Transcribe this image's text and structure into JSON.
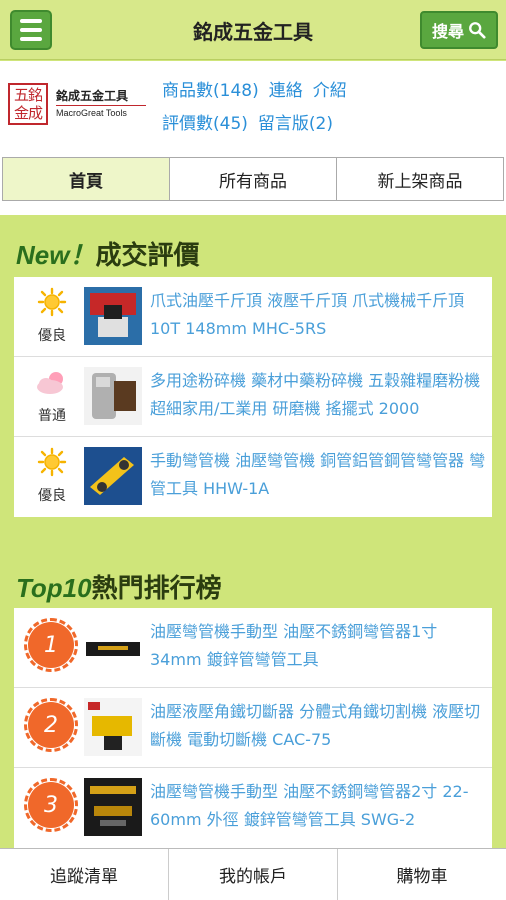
{
  "header": {
    "title": "銘成五金工具",
    "search_label": "搜尋"
  },
  "store": {
    "logo_mark": "五銘金成",
    "logo_name": "銘成五金工具",
    "logo_en": "MacroGreat Tools",
    "products_count": "商品數(148)",
    "contact": "連絡",
    "intro": "介紹",
    "reviews_count": "評價數(45)",
    "guestbook": "留言版(2)"
  },
  "tabs": [
    {
      "label": "首頁"
    },
    {
      "label": "所有商品"
    },
    {
      "label": "新上架商品"
    }
  ],
  "reviews": {
    "title_prefix": "New！",
    "title": "成交評價",
    "items": [
      {
        "rating": "優良",
        "icon": "sun-icon",
        "text": "爪式油壓千斤頂 液壓千斤頂 爪式機械千斤頂 10T 148mm MHC-5RS"
      },
      {
        "rating": "普通",
        "icon": "cloud-sun-icon",
        "text": "多用途粉碎機 藥材中藥粉碎機 五穀雜糧磨粉機 超細家用/工業用 研磨機 搖擺式 2000"
      },
      {
        "rating": "優良",
        "icon": "sun-icon",
        "text": "手動彎管機 油壓彎管機 銅管鋁管鋼管彎管器 彎管工具 HHW-1A"
      }
    ]
  },
  "top10": {
    "title_prefix": "Top10",
    "title": "熱門排行榜",
    "items": [
      {
        "rank": "1",
        "text": "油壓彎管機手動型 油壓不銹鋼彎管器1寸 34mm 鍍鋅管彎管工具"
      },
      {
        "rank": "2",
        "text": "油壓液壓角鐵切斷器 分體式角鐵切割機 液壓切斷機 電動切斷機 CAC-75"
      },
      {
        "rank": "3",
        "text": "油壓彎管機手動型 油壓不銹鋼彎管器2寸 22-60mm 外徑 鍍鋅管彎管工具 SWG-2"
      }
    ]
  },
  "bottom_nav": [
    {
      "label": "追蹤清單"
    },
    {
      "label": "我的帳戶"
    },
    {
      "label": "購物車"
    }
  ],
  "colors": {
    "accent_green": "#5aa73f",
    "background": "#cfe57a",
    "link_blue": "#4a9fd9",
    "rank_orange": "#f0682a"
  }
}
